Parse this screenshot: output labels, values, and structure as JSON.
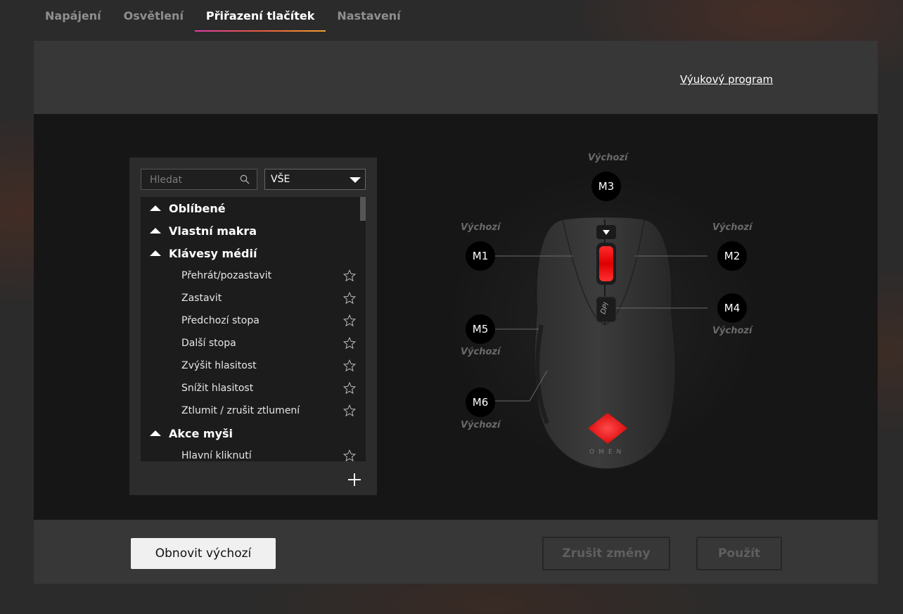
{
  "tabs": [
    {
      "label": "Napájení",
      "active": false
    },
    {
      "label": "Osvětlení",
      "active": false
    },
    {
      "label": "Přiřazení tlačítek",
      "active": true
    },
    {
      "label": "Nastavení",
      "active": false
    }
  ],
  "header": {
    "tutorial_link": "Výukový program"
  },
  "library": {
    "search_placeholder": "Hledat",
    "filter_value": "VŠE",
    "categories": [
      {
        "label": "Oblíbené"
      },
      {
        "label": "Vlastní makra"
      },
      {
        "label": "Klávesy médií",
        "items": [
          "Přehrát/pozastavit",
          "Zastavit",
          "Předchozí stopa",
          "Další stopa",
          "Zvýšit hlasitost",
          "Snížit hlasitost",
          "Ztlumit / zrušit ztlumení"
        ]
      },
      {
        "label": "Akce myši",
        "items": [
          "Hlavní kliknutí"
        ]
      }
    ]
  },
  "mouse": {
    "brand": "OMEN",
    "dpi_label": "DPI",
    "buttons": [
      {
        "id": "M1",
        "assignment": "Výchozí"
      },
      {
        "id": "M2",
        "assignment": "Výchozí"
      },
      {
        "id": "M3",
        "assignment": "Výchozí"
      },
      {
        "id": "M4",
        "assignment": "Výchozí"
      },
      {
        "id": "M5",
        "assignment": "Výchozí"
      },
      {
        "id": "M6",
        "assignment": "Výchozí"
      }
    ]
  },
  "footer": {
    "restore_label": "Obnovit výchozí",
    "cancel_label": "Zrušit změny",
    "apply_label": "Použít"
  },
  "colors": {
    "accent_gradient": [
      "#e23ca6",
      "#e85a3d",
      "#f2a230"
    ],
    "mouse_led": "#ff1a1a"
  }
}
